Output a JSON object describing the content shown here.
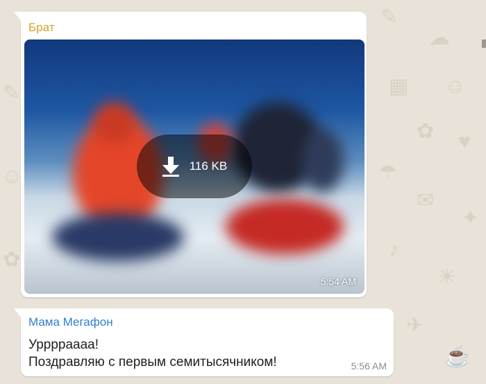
{
  "messages": [
    {
      "sender": "Брат",
      "sender_color": "#d4a12c",
      "type": "image",
      "download_icon": "download-arrow-icon",
      "download_size": "116 KB",
      "time": "5:54 AM"
    },
    {
      "sender": "Мама Мегафон",
      "sender_color": "#2f7fd3",
      "type": "text",
      "text_line1": "Урррраааа!",
      "text_line2": "Поздравляю с первым семитысячником!",
      "time": "5:56 AM"
    }
  ],
  "colors": {
    "wallpaper": "#e8e2d8",
    "bubble": "#ffffff"
  }
}
